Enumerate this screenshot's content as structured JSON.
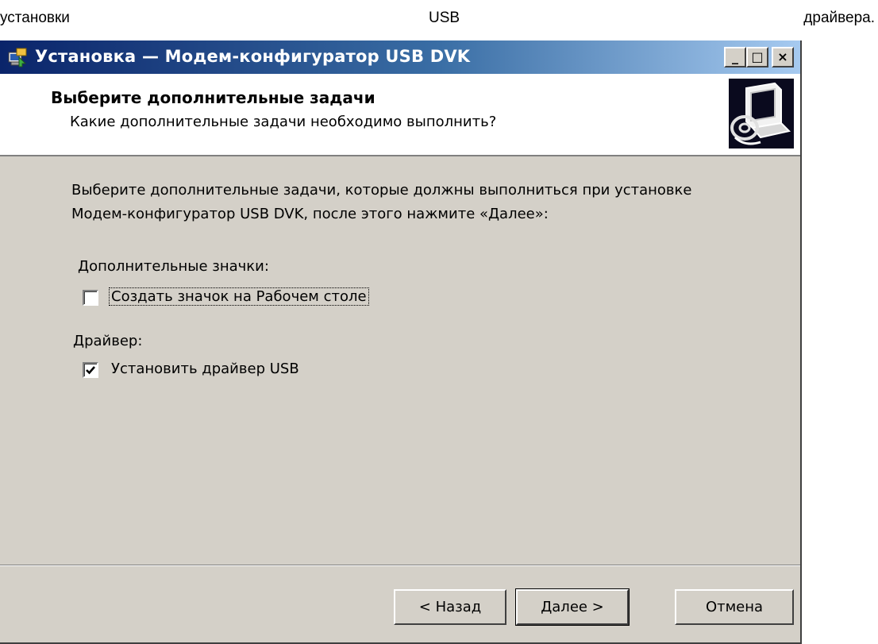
{
  "document": {
    "words": [
      "установки",
      "USB",
      "драйвера."
    ]
  },
  "window": {
    "title": "Установка — Модем-конфигуратор USB DVK",
    "controls": {
      "minimize": "_",
      "maximize": "□",
      "close": "×"
    }
  },
  "header": {
    "title": "Выберите дополнительные задачи",
    "subtitle": "Какие дополнительные задачи необходимо выполнить?"
  },
  "content": {
    "description": "Выберите дополнительные задачи, которые должны выполниться при установке Модем-конфигуратор USB DVK, после этого нажмите «Далее»:",
    "groups": [
      {
        "label": "Дополнительные значки:",
        "options": [
          {
            "label": "Создать значок на Рабочем столе",
            "checked": false
          }
        ]
      },
      {
        "label": "Драйвер:",
        "options": [
          {
            "label": "Установить драйвер USB",
            "checked": true
          }
        ]
      }
    ]
  },
  "footer": {
    "back": "< Назад",
    "next": "Далее >",
    "cancel": "Отмена"
  },
  "icons": [
    "installer-icon",
    "computer-cd-icon",
    "checkmark-icon"
  ],
  "colors": {
    "titlebar_start": "#0a246a",
    "titlebar_end": "#a6caf0",
    "dialog_face": "#d4d0c8",
    "header_bg": "#ffffff"
  }
}
